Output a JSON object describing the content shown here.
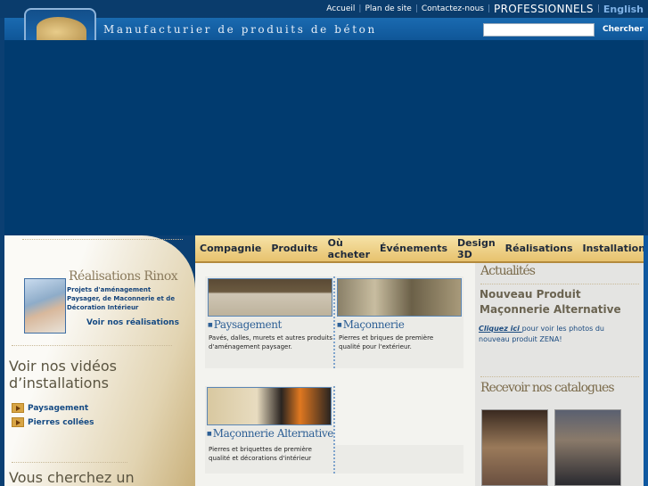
{
  "header": {
    "links": [
      "Accueil",
      "Plan de site",
      "Contactez-nous"
    ],
    "professionals": "PROFESSIONNELS",
    "language": "English",
    "tagline": "Manufacturier de produits de béton",
    "search_placeholder": "",
    "search_button": "Chercher"
  },
  "nav": [
    "Compagnie",
    "Produits",
    "Où acheter",
    "Événements",
    "Design 3D",
    "Réalisations",
    "Installation"
  ],
  "left": {
    "realisations_title": "Réalisations Rinox",
    "realisations_desc": "Projets d'aménagement Paysager, de Maconnerie et de Décoration Intérieur",
    "realisations_link": "Voir nos réalisations",
    "videos_title": "Voir nos vidéos d’installations",
    "videos": [
      "Paysagement",
      "Pierres collées"
    ],
    "search_title": "Vous cherchez un"
  },
  "products": [
    {
      "title": "Paysagement",
      "desc": "Pavés, dalles, murets et autres produits d'aménagement paysager."
    },
    {
      "title": "Maçonnerie",
      "desc": "Pierres et briques de première qualité pour l'extérieur."
    },
    {
      "title": "Maçonnerie Alternative",
      "desc": "Pierres et briquettes de première qualité et décorations d'intérieur"
    }
  ],
  "right": {
    "news_title": "Actualités",
    "news_headline": "Nouveau Produit Maçonnerie Alternative",
    "news_link": "Cliquez ici ",
    "news_text": "pour voir les photos du nouveau produit ZENA!",
    "catalog_title": "Recevoir nos catalogues"
  }
}
